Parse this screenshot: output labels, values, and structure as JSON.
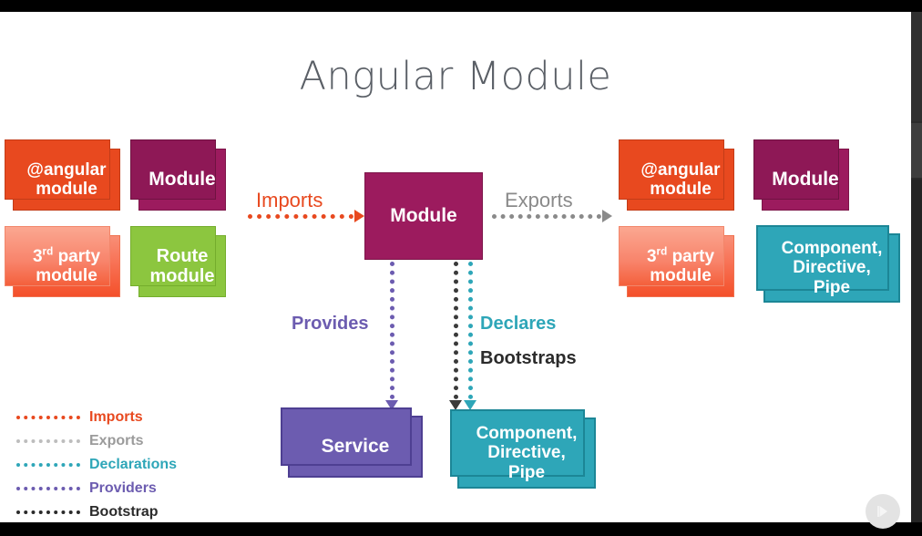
{
  "slide": {
    "title": "Angular Module"
  },
  "center": {
    "module_label": "Module"
  },
  "imports_group": [
    {
      "label_line1": "@angular",
      "label_line2": "module",
      "style": "orange"
    },
    {
      "label_line1": "Module",
      "label_line2": "",
      "style": "magenta"
    },
    {
      "label_prefix": "3",
      "label_ord": "rd",
      "label_suffix": " party",
      "label_line2": "module",
      "style": "salmon"
    },
    {
      "label_line1": "Route",
      "label_line2": "module",
      "style": "green"
    }
  ],
  "exports_group": [
    {
      "label_line1": "@angular",
      "label_line2": "module",
      "style": "orange"
    },
    {
      "label_line1": "Module",
      "label_line2": "",
      "style": "magenta"
    },
    {
      "label_prefix": "3",
      "label_ord": "rd",
      "label_suffix": " party",
      "label_line2": "module",
      "style": "salmon"
    },
    {
      "label_line1": "Component,",
      "label_line2": "Directive,",
      "label_line3": "Pipe",
      "style": "teal"
    }
  ],
  "bottom_group": [
    {
      "label_line1": "Service",
      "style": "purple"
    },
    {
      "label_line1": "Component,",
      "label_line2": "Directive,",
      "label_line3": "Pipe",
      "style": "teal"
    }
  ],
  "edges": {
    "imports": "Imports",
    "exports": "Exports",
    "provides": "Provides",
    "declares": "Declares",
    "bootstraps": "Bootstraps"
  },
  "legend": {
    "items": [
      {
        "label": "Imports",
        "color": "#e8491f"
      },
      {
        "label": "Exports",
        "color": "#9b9b9b"
      },
      {
        "label": "Declarations",
        "color": "#2ea6b8"
      },
      {
        "label": "Providers",
        "color": "#6c5cb0"
      },
      {
        "label": "Bootstrap",
        "color": "#2b2b2b"
      }
    ]
  },
  "controls": {
    "play_icon": "play-next-icon"
  },
  "colors": {
    "orange": "#e8491f",
    "salmon": "#f4502a",
    "magenta": "#9c1b5e",
    "green": "#8cc63f",
    "teal": "#2ea6b8",
    "purple": "#6c5cb0",
    "title_gray": "#5a5f66"
  }
}
